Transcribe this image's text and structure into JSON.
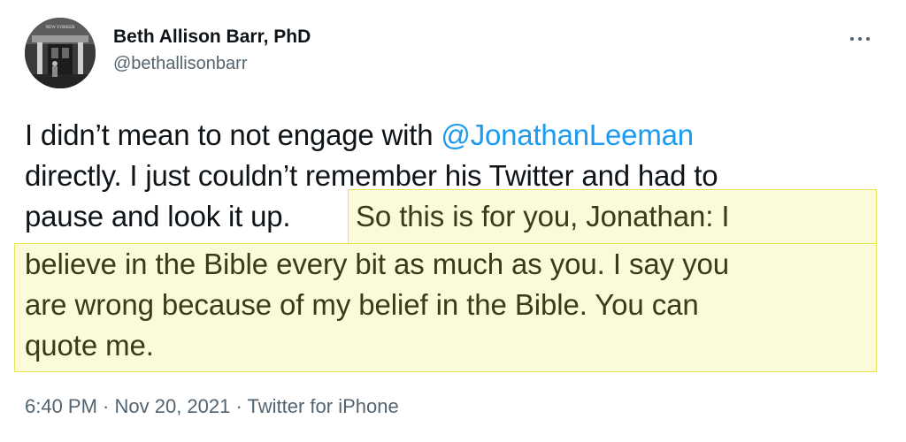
{
  "author": {
    "display_name": "Beth Allison Barr, PhD",
    "handle": "@bethallisonbarr",
    "avatar_caption": "NEW YORKER"
  },
  "tweet": {
    "text_before_mention": "I didn’t mean to not engage with ",
    "mention": "@JonathanLeeman",
    "text_line2": "directly. I just couldn’t remember his Twitter and had to",
    "text_line3_plain": "pause and look it up. ",
    "highlighted_lines": [
      "So this is for you, Jonathan: I",
      "believe in the Bible every bit as much as you. I say you",
      "are wrong because of my belief in the Bible. You can",
      "quote me."
    ]
  },
  "meta": {
    "time": "6:40 PM",
    "separator": " · ",
    "date": "Nov 20, 2021",
    "source": "Twitter for iPhone"
  },
  "colors": {
    "mention": "#1d9bf0",
    "highlight_fill": "#fbfbdc",
    "highlight_border": "#e4e457",
    "secondary_text": "#536471"
  },
  "icons": {
    "more": "more-horizontal-icon"
  }
}
